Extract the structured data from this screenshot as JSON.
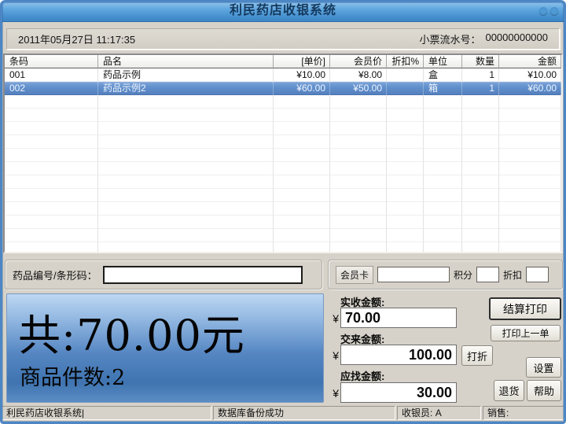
{
  "window": {
    "title": "利民药店收银系统"
  },
  "header": {
    "datetime": "2011年05月27日  11:17:35",
    "receipt_label": "小票流水号：",
    "receipt_no": "00000000000"
  },
  "table": {
    "columns": [
      "条码",
      "品名",
      "[单价]",
      "会员价",
      "折扣%",
      "单位",
      "数量",
      "金额"
    ],
    "rows": [
      [
        "001",
        "药品示例",
        "¥10.00",
        "¥8.00",
        "",
        "盒",
        "1",
        "¥10.00"
      ],
      [
        "002",
        "药品示例2",
        "¥60.00",
        "¥50.00",
        "",
        "箱",
        "1",
        "¥60.00"
      ]
    ],
    "selected_row": 1,
    "empty_rows": 12
  },
  "barcode": {
    "label": "药品编号/条形码：",
    "value": ""
  },
  "member": {
    "card_label": "会员卡",
    "card_value": "",
    "points_label": "积分",
    "points_value": "",
    "discount_label": "折扣",
    "discount_value": ""
  },
  "display": {
    "total_label": "共:",
    "total_amount": "70.00",
    "total_unit": "元",
    "count_label": "商品件数:",
    "count_value": "2"
  },
  "payment": {
    "currency": "¥",
    "received_label": "实收金额:",
    "received_value": "70.00",
    "tendered_label": "交来金额:",
    "tendered_value": "100.00",
    "change_label": "应找金额:",
    "change_value": "30.00",
    "discount_button": "打折",
    "settle_button": "结算打印",
    "print_last_button": "打印上一单",
    "settings_button": "设置",
    "refund_button": "退货",
    "help_button": "帮助"
  },
  "statusbar": {
    "app_text": "利民药店收银系统|",
    "message": "数据库备份成功",
    "cashier_label": "收银员:",
    "cashier_value": "A",
    "sales_label": "销售:"
  },
  "colors": {
    "titlebar_blue": "#4690cf",
    "window_frame": "#4d86c4",
    "selected_row": "#5b86c4",
    "display_top": "#bdd8f2",
    "display_bottom": "#3f74b0"
  }
}
